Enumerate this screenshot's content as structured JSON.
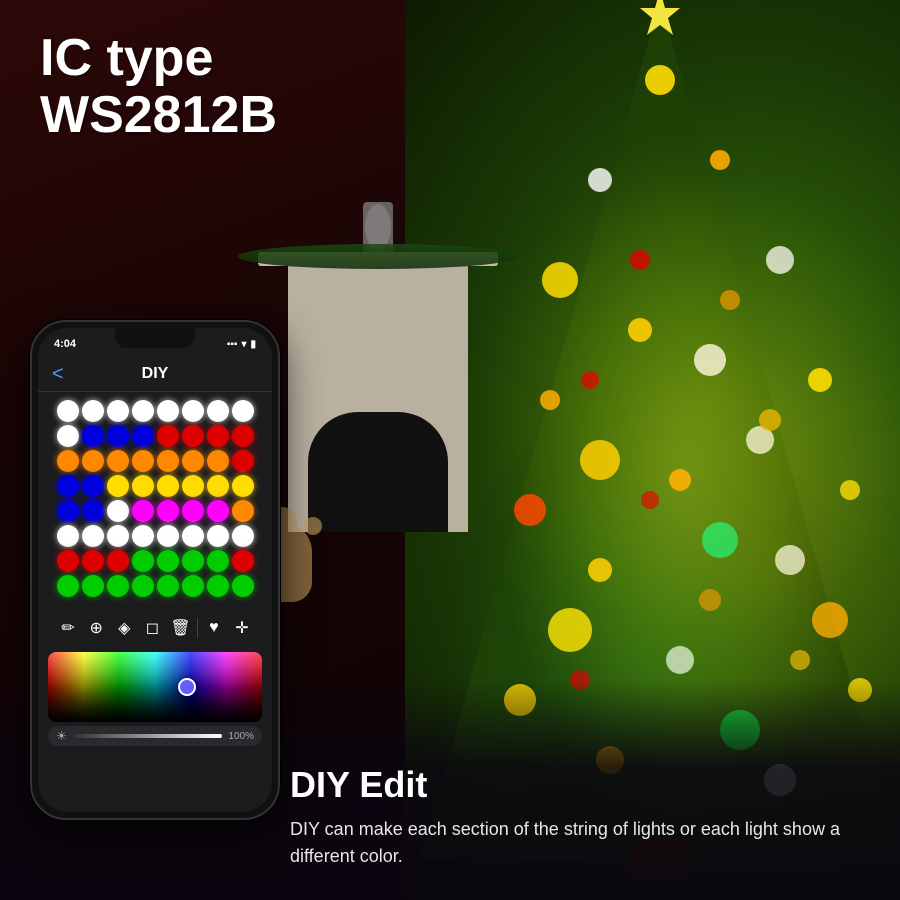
{
  "ic_type": {
    "line1": "IC type",
    "line2": "WS2812B"
  },
  "phone": {
    "status_time": "4:04",
    "status_icons": "▪▪▪ ▾ ▮",
    "header_title": "DIY",
    "back_arrow": "<",
    "brightness_label": "100%",
    "brightness_icon": "☀"
  },
  "diy_section": {
    "title": "DIY Edit",
    "description": "DIY can make each section of the string of lights or each light show a different color."
  },
  "led_grid": {
    "rows": [
      [
        "#ffffff",
        "#ffffff",
        "#ffffff",
        "#ffffff",
        "#ffffff",
        "#ffffff",
        "#ffffff",
        "#ffffff"
      ],
      [
        "#ffffff",
        "#0000dd",
        "#0000dd",
        "#0000dd",
        "#dd0000",
        "#dd0000",
        "#dd0000",
        "#dd0000"
      ],
      [
        "#ff8800",
        "#ff8800",
        "#ff8800",
        "#ff8800",
        "#ff8800",
        "#ff8800",
        "#ff8800",
        "#dd0000"
      ],
      [
        "#0000dd",
        "#0000dd",
        "#ffdd00",
        "#ffdd00",
        "#ffdd00",
        "#ffdd00",
        "#ffdd00",
        "#ffdd00"
      ],
      [
        "#0000dd",
        "#0000dd",
        "#ffffff",
        "#ff00ff",
        "#ff00ff",
        "#ff00ff",
        "#ff00ff",
        "#ff8800"
      ],
      [
        "#ffffff",
        "#ffffff",
        "#ffffff",
        "#ffffff",
        "#ffffff",
        "#ffffff",
        "#ffffff",
        "#ffffff"
      ],
      [
        "#dd0000",
        "#dd0000",
        "#dd0000",
        "#00cc00",
        "#00cc00",
        "#00cc00",
        "#00cc00",
        "#dd0000"
      ],
      [
        "#00cc00",
        "#00cc00",
        "#00cc00",
        "#00cc00",
        "#00cc00",
        "#00cc00",
        "#00cc00",
        "#00cc00"
      ]
    ]
  }
}
